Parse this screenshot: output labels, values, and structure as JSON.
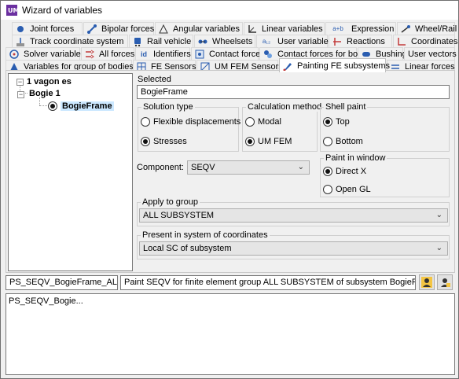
{
  "window": {
    "title": "Wizard of variables"
  },
  "tabs": {
    "row1": [
      {
        "label": "Joint forces",
        "icon": "joint-forces-icon"
      },
      {
        "label": "Bipolar forces",
        "icon": "bipolar-forces-icon"
      },
      {
        "label": "Angular variables",
        "icon": "angular-variables-icon"
      },
      {
        "label": "Linear variables",
        "icon": "linear-variables-icon"
      },
      {
        "label": "Expression",
        "icon": "expression-icon",
        "glyph": "a+b"
      },
      {
        "label": "Wheel/Rail",
        "icon": "wheel-rail-icon"
      }
    ],
    "row2": [
      {
        "label": "Track coordinate system",
        "icon": "track-coordinate-icon"
      },
      {
        "label": "Rail vehicle",
        "icon": "rail-vehicle-icon"
      },
      {
        "label": "Wheelsets",
        "icon": "wheelsets-icon"
      },
      {
        "label": "User variables",
        "icon": "user-variables-icon",
        "glyph": "a₁₂"
      },
      {
        "label": "Reactions",
        "icon": "reactions-icon"
      },
      {
        "label": "Coordinates",
        "icon": "coordinates-icon"
      }
    ],
    "row3": [
      {
        "label": "Solver variables",
        "icon": "solver-variables-icon"
      },
      {
        "label": "All forces",
        "icon": "all-forces-icon"
      },
      {
        "label": "Identifiers",
        "icon": "identifiers-icon",
        "glyph": "id"
      },
      {
        "label": "Contact forces",
        "icon": "contact-forces-icon"
      },
      {
        "label": "Contact forces for bodies",
        "icon": "contact-forces-bodies-icon"
      },
      {
        "label": "Bushing",
        "icon": "bushing-icon"
      },
      {
        "label": "User vectors",
        "icon": ""
      }
    ],
    "row4": [
      {
        "label": "Variables for group of bodies",
        "icon": "group-variables-icon"
      },
      {
        "label": "FE Sensors",
        "icon": "fe-sensors-icon"
      },
      {
        "label": "UM FEM Sensors",
        "icon": "um-fem-sensors-icon"
      },
      {
        "label": "Painting FE subsystems",
        "icon": "painting-fe-icon",
        "active": true
      },
      {
        "label": "Linear forces",
        "icon": "linear-forces-icon"
      }
    ]
  },
  "tree": {
    "root": "1 vagon es",
    "child": "Bogie 1",
    "leaf": "BogieFrame"
  },
  "selected": {
    "label": "Selected",
    "value": "BogieFrame"
  },
  "solution_type": {
    "title": "Solution type",
    "options": [
      "Flexible displacements",
      "Stresses"
    ],
    "selected": "Stresses"
  },
  "calc_method": {
    "title": "Calculation method",
    "options": [
      "Modal",
      "UM FEM"
    ],
    "selected": "UM FEM"
  },
  "shell_paint": {
    "title": "Shell paint",
    "options": [
      "Top",
      "Bottom"
    ],
    "selected": "Top"
  },
  "component": {
    "label": "Component:",
    "value": "SEQV"
  },
  "paint_window": {
    "title": "Paint in window",
    "options": [
      "Direct X",
      "Open GL"
    ],
    "selected": "Direct X"
  },
  "apply_group": {
    "title": "Apply to group",
    "value": "ALL SUBSYSTEM"
  },
  "coord_system": {
    "title": "Present in system of coordinates",
    "value": "Local SC of subsystem"
  },
  "bottom": {
    "name_value": "PS_SEQV_BogieFrame_ALL SUBSYS",
    "desc_value": "Paint SEQV for finite element group ALL SUBSYSTEM of subsystem BogieFrame",
    "log_text": "PS_SEQV_Bogie..."
  },
  "colors": {
    "accent": "#0078d7",
    "selection": "#cce8ff"
  }
}
